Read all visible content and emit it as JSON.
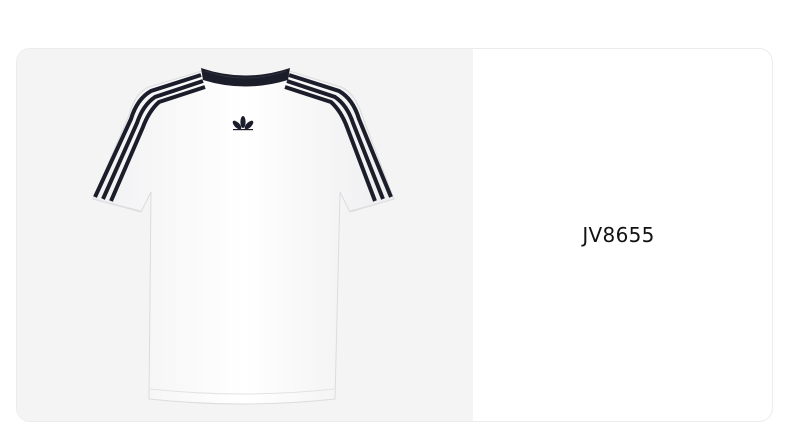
{
  "product": {
    "image_icon": "tshirt-image",
    "logo_icon": "trefoil-logo-icon",
    "sku": "JV8655"
  },
  "colors": {
    "card_background": "#ffffff",
    "image_background": "#f4f4f4",
    "shirt": "#ffffff",
    "stripes": "#1b1d2a",
    "text": "#111111"
  }
}
